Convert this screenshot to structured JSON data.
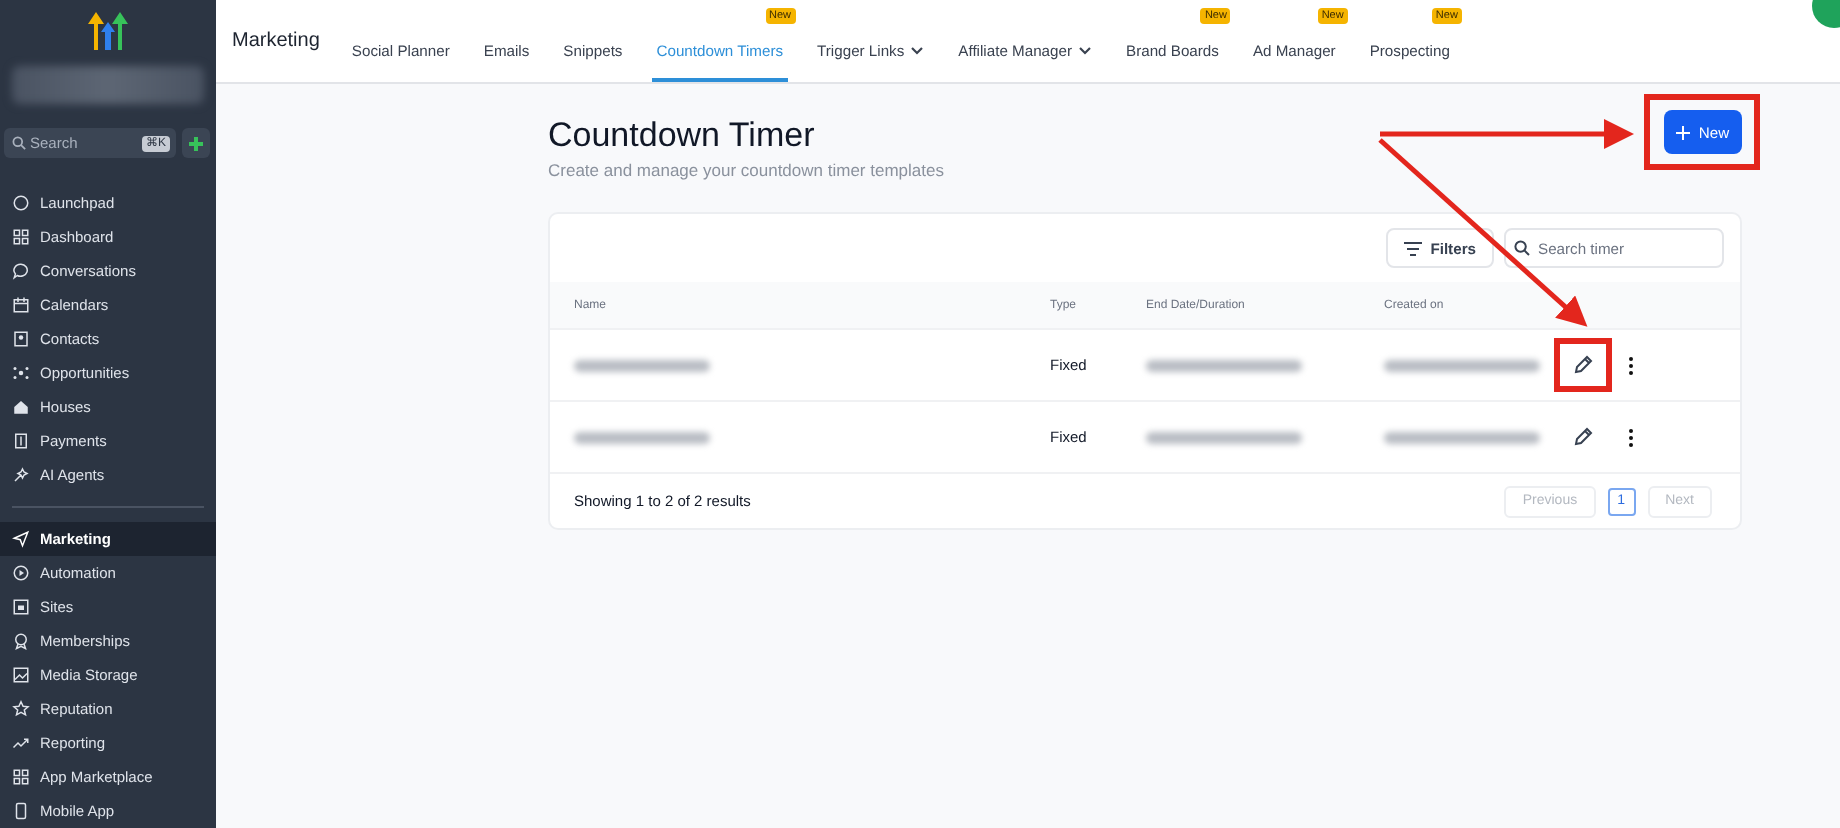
{
  "sidebar": {
    "search": {
      "placeholder": "Search",
      "shortcut": "⌘K"
    },
    "groups": [
      [
        {
          "label": "Launchpad",
          "selected": false
        },
        {
          "label": "Dashboard",
          "selected": false
        },
        {
          "label": "Conversations",
          "selected": false
        },
        {
          "label": "Calendars",
          "selected": false
        },
        {
          "label": "Contacts",
          "selected": false
        },
        {
          "label": "Opportunities",
          "selected": false
        },
        {
          "label": "Houses",
          "selected": false
        },
        {
          "label": "Payments",
          "selected": false
        },
        {
          "label": "AI Agents",
          "selected": false
        }
      ],
      [
        {
          "label": "Marketing",
          "selected": true
        },
        {
          "label": "Automation",
          "selected": false
        },
        {
          "label": "Sites",
          "selected": false
        },
        {
          "label": "Memberships",
          "selected": false
        },
        {
          "label": "Media Storage",
          "selected": false
        },
        {
          "label": "Reputation",
          "selected": false
        },
        {
          "label": "Reporting",
          "selected": false
        },
        {
          "label": "App Marketplace",
          "selected": false
        },
        {
          "label": "Mobile App",
          "selected": false
        }
      ]
    ]
  },
  "topnav": {
    "title": "Marketing",
    "tabs": [
      {
        "label": "Social Planner",
        "selected": false,
        "dropdown": false
      },
      {
        "label": "Emails",
        "selected": false,
        "dropdown": false
      },
      {
        "label": "Snippets",
        "selected": false,
        "dropdown": false
      },
      {
        "label": "Countdown Timers",
        "selected": true,
        "dropdown": false,
        "badge": "New"
      },
      {
        "label": "Trigger Links",
        "selected": false,
        "dropdown": true
      },
      {
        "label": "Affiliate Manager",
        "selected": false,
        "dropdown": true
      },
      {
        "label": "Brand Boards",
        "selected": false,
        "dropdown": false,
        "badge": "New"
      },
      {
        "label": "Ad Manager",
        "selected": false,
        "dropdown": false,
        "badge": "New"
      },
      {
        "label": "Prospecting",
        "selected": false,
        "dropdown": false,
        "badge": "New"
      }
    ]
  },
  "page": {
    "title": "Countdown Timer",
    "subtitle": "Create and manage your countdown timer templates",
    "new_button": {
      "label": "New",
      "highlighted": true
    }
  },
  "table": {
    "filters_button": "Filters",
    "search": {
      "placeholder": "Search timer"
    },
    "columns": [
      "Name",
      "Type",
      "End Date/Duration",
      "Created on"
    ],
    "rows": [
      {
        "type": "Fixed",
        "edit_highlighted": true
      },
      {
        "type": "Fixed",
        "edit_highlighted": false
      }
    ],
    "summary": "Showing 1 to 2 of 2 results",
    "pagination": {
      "previous": {
        "label": "Previous",
        "disabled": true
      },
      "pages": [
        {
          "label": "1",
          "selected": true
        }
      ],
      "next": {
        "label": "Next",
        "disabled": true
      }
    }
  }
}
